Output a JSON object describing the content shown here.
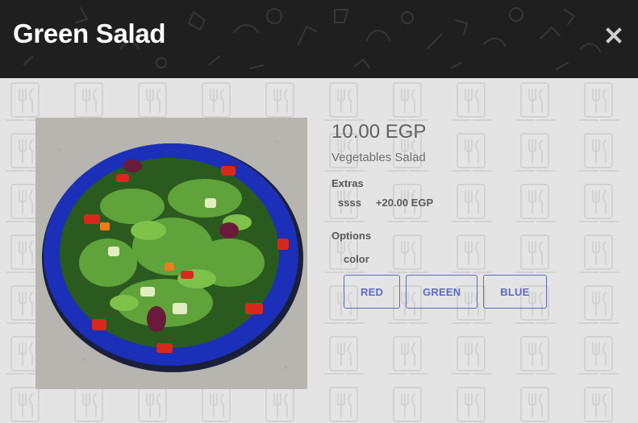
{
  "modal": {
    "title": "Green Salad",
    "close_icon": "close-icon"
  },
  "product": {
    "price": "10.00 EGP",
    "description": "Vegetables Salad",
    "image_icon": "salad-bowl-photo"
  },
  "extras": {
    "label": "Extras",
    "items": [
      {
        "name": "ssss",
        "price": "+20.00 EGP"
      }
    ]
  },
  "options": {
    "label": "Options",
    "groups": [
      {
        "name": "color",
        "choices": [
          "RED",
          "GREEN",
          "BLUE"
        ]
      }
    ]
  },
  "colors": {
    "header_bg": "#1f1f1f",
    "body_bg": "#e4e4e4",
    "accent": "#5c6bc0",
    "text": "#5a5a5a"
  }
}
